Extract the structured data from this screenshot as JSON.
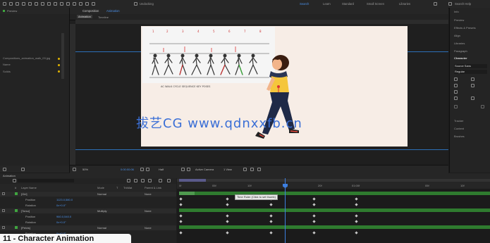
{
  "toolbar": {
    "menu_hint": "Undocking",
    "workspaces": [
      "Search",
      "Learn",
      "Standard",
      "Small Screen",
      "Libraries",
      "Search Help"
    ]
  },
  "project": {
    "item_name": "Compositions_animation_walk_03.jpg",
    "rows": [
      "Preview",
      "Name",
      "Solids"
    ]
  },
  "composition": {
    "panel_title": "Composition",
    "comp_name": "Animation",
    "sub_tab": "Timeline",
    "footer": {
      "zoom": "50%",
      "time": "0:00:00:06",
      "resolution": "Half",
      "view": "Active Camera",
      "views": "1 View"
    }
  },
  "reference_sheet": {
    "caption": "AC WALK CYCLE SEQUENCE KEY POSES"
  },
  "right_panel": {
    "items": [
      "Info",
      "Preview",
      "Effects & Presets",
      "Align",
      "Libraries",
      "Paragraph",
      "Character",
      "Tracker",
      "Content",
      "Brushes"
    ],
    "font_name": "Source Sans",
    "font_style": "Regular"
  },
  "watermark": "拔艺CG www.qdnxxfb.cn",
  "timeline": {
    "search_placeholder": "",
    "columns": [
      "#",
      "Layer Name",
      "Mode",
      "T",
      "TrkMat",
      "Parent & Link"
    ],
    "layers": [
      {
        "name": "[Girl]",
        "value": "",
        "mode": "Normal",
        "parent": "None"
      },
      {
        "name": "Position",
        "value": "1123.0,580.0",
        "mode": "",
        "parent": ""
      },
      {
        "name": "Rotation",
        "value": "0x+0.0°",
        "mode": "",
        "parent": ""
      },
      {
        "name": "[Torso]",
        "value": "",
        "mode": "Multiply",
        "parent": "None"
      },
      {
        "name": "Position",
        "value": "960.0,540.0",
        "mode": "",
        "parent": ""
      },
      {
        "name": "Rotation",
        "value": "0x+0.0°",
        "mode": "",
        "parent": ""
      },
      {
        "name": "[Pelvis]",
        "value": "",
        "mode": "Normal",
        "parent": "None"
      },
      {
        "name": "Rotation",
        "value": "0x+0.0°",
        "mode": "",
        "parent": ""
      }
    ],
    "ruler_labels": [
      "0f",
      "05f",
      "10f",
      "15f",
      "20f",
      "01:00f",
      "05f",
      "10f"
    ],
    "tooltip": "Time Ruler (Click to set thumb)"
  },
  "badge_title": "11 - Character Animation"
}
